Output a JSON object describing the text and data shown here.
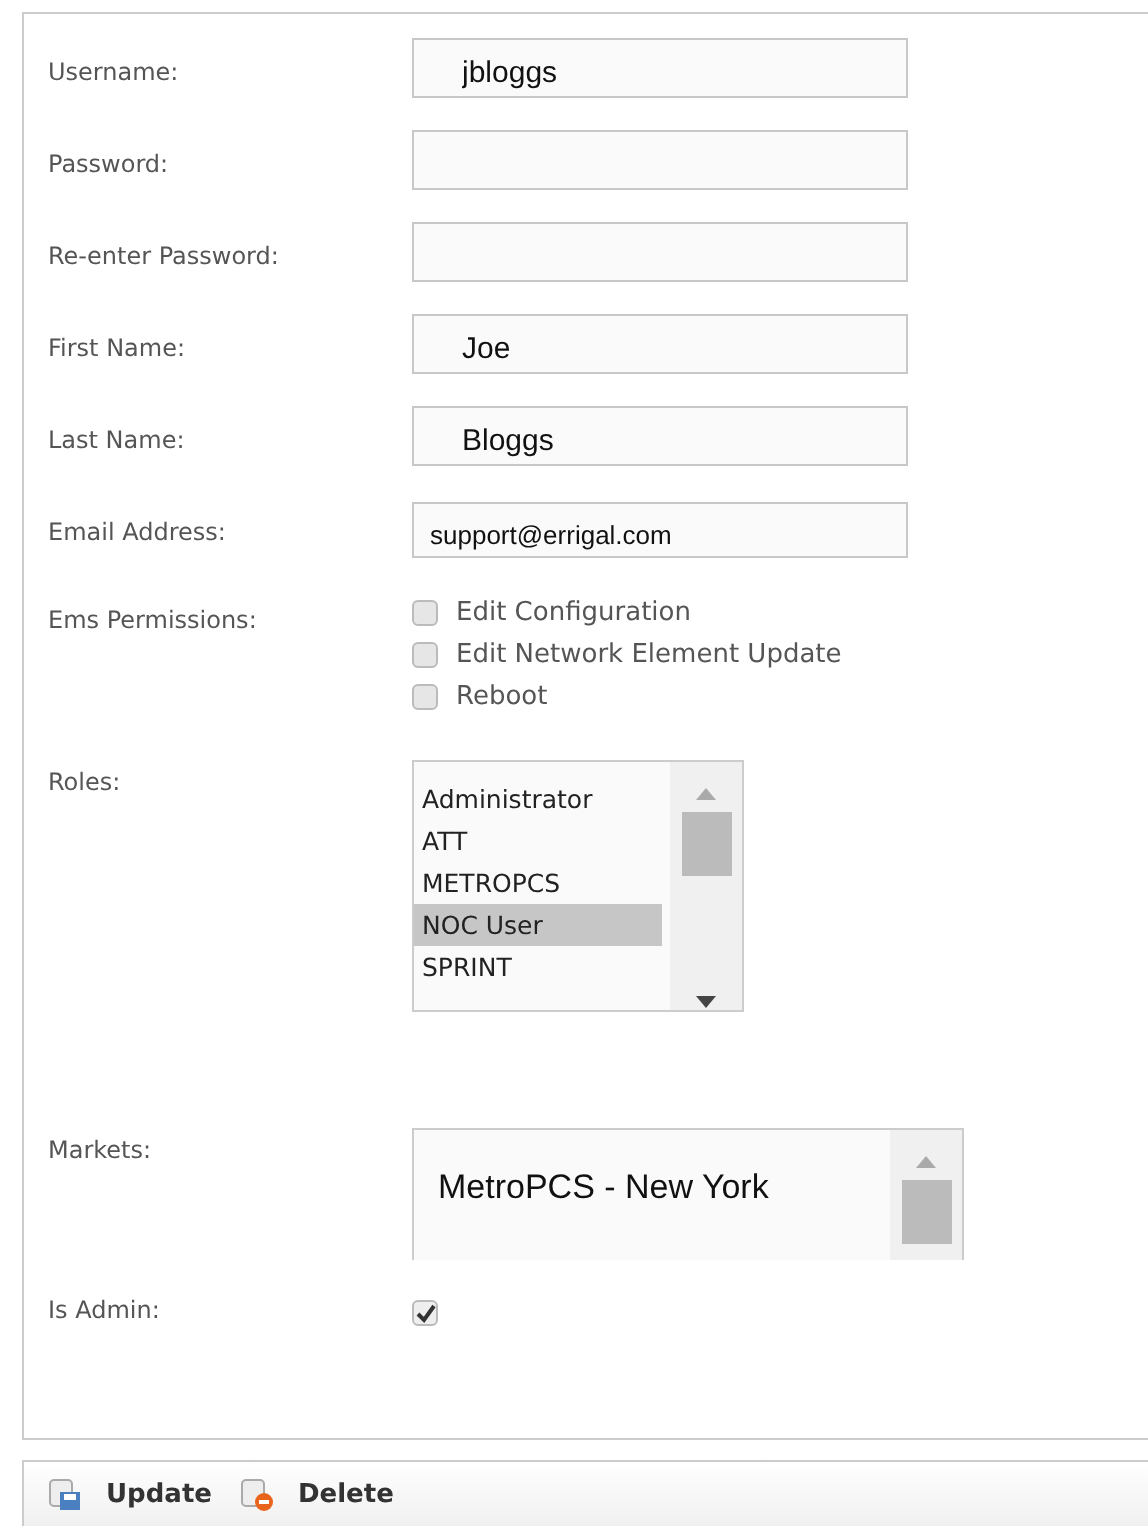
{
  "fields": [
    {
      "kind": "text",
      "label": "Username:",
      "value": "jbloggs"
    },
    {
      "kind": "text",
      "label": "Password:"
    },
    {
      "kind": "text",
      "label": "Re-enter Password:"
    },
    {
      "kind": "text",
      "label": "First Name:",
      "value": "Joe"
    },
    {
      "kind": "text",
      "label": "Last Name:",
      "value": "Bloggs"
    },
    {
      "kind": "email",
      "label": "Email Address:",
      "value": "support@errigal.com"
    },
    {
      "kind": "checkboxes",
      "label": "Ems Permissions:",
      "options": [
        {
          "label": "Edit Configuration",
          "checked": false
        },
        {
          "label": "Edit Network Element Update",
          "checked": false
        },
        {
          "label": "Reboot",
          "checked": false
        }
      ]
    },
    {
      "kind": "listbox",
      "label": "Roles:",
      "items": [
        {
          "label": "Administrator",
          "selected": false
        },
        {
          "label": "ATT",
          "selected": false
        },
        {
          "label": "METROPCS",
          "selected": false
        },
        {
          "label": "NOC User",
          "selected": true
        },
        {
          "label": "SPRINT",
          "selected": false
        }
      ]
    },
    {
      "kind": "biglist",
      "label": "Markets:",
      "items": [
        {
          "label": "MetroPCS - New York",
          "selected": false
        }
      ]
    },
    {
      "kind": "checkbox",
      "label": "Is Admin:",
      "checked": true
    }
  ],
  "toolbar": [
    {
      "label": "Update",
      "kind": "save"
    },
    {
      "label": "Delete",
      "kind": "delete"
    }
  ]
}
